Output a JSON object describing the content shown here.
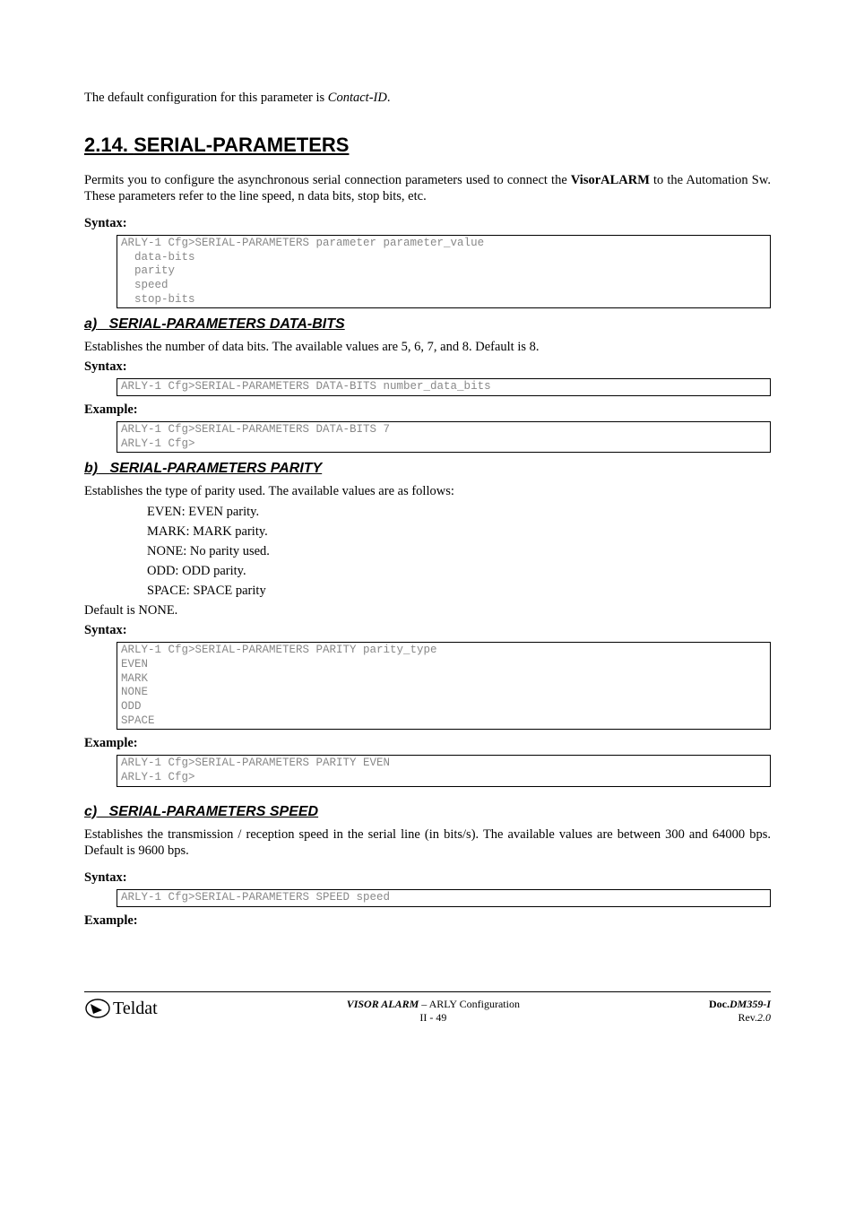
{
  "intro": {
    "defaultConfig_pre": "The default configuration for this parameter is ",
    "defaultConfig_em": "Contact-ID",
    "defaultConfig_post": "."
  },
  "section": {
    "number": "2.14.",
    "title": "SERIAL-PARAMETERS",
    "desc_pre": "Permits you to configure the asynchronous serial connection parameters used to connect the ",
    "desc_bold": "VisorALARM",
    "desc_post": " to the Automation Sw.  These parameters refer to the line speed, n data bits, stop bits, etc.",
    "syntax_label": "Syntax:",
    "syntax_code": "ARLY-1 Cfg>SERIAL-PARAMETERS parameter parameter_value\n  data-bits\n  parity\n  speed\n  stop-bits"
  },
  "a": {
    "heading_letter": "a)",
    "heading_text": "SERIAL-PARAMETERS DATA-BITS",
    "desc": "Establishes the number of data bits.  The available values are 5, 6, 7, and 8.  Default is 8.",
    "syntax_label": "Syntax:",
    "syntax_code": "ARLY-1 Cfg>SERIAL-PARAMETERS DATA-BITS number_data_bits",
    "example_label": "Example:",
    "example_code": "ARLY-1 Cfg>SERIAL-PARAMETERS DATA-BITS 7\nARLY-1 Cfg>"
  },
  "b": {
    "heading_letter": "b)",
    "heading_text": "SERIAL-PARAMETERS PARITY",
    "desc": "Establishes the type of parity used.  The available values are as follows:",
    "items": {
      "even": "EVEN: EVEN parity.",
      "mark": "MARK: MARK parity.",
      "none": "NONE: No parity used.",
      "odd": "ODD: ODD parity.",
      "space": "SPACE: SPACE parity"
    },
    "default": "Default is NONE.",
    "syntax_label": "Syntax:",
    "syntax_code": "ARLY-1 Cfg>SERIAL-PARAMETERS PARITY parity_type\nEVEN\nMARK\nNONE\nODD\nSPACE",
    "example_label": "Example:",
    "example_code": "ARLY-1 Cfg>SERIAL-PARAMETERS PARITY EVEN\nARLY-1 Cfg>"
  },
  "c": {
    "heading_letter": "c)",
    "heading_text": "SERIAL-PARAMETERS SPEED",
    "desc": "Establishes the transmission / reception speed in the serial line (in bits/s).  The available values are between 300 and 64000 bps.  Default is 9600 bps.",
    "syntax_label": "Syntax:",
    "syntax_code": "ARLY-1 Cfg>SERIAL-PARAMETERS SPEED speed",
    "example_label": "Example:"
  },
  "footer": {
    "logo_text": "Teldat",
    "center_main_italic": "VISOR ALARM",
    "center_main_rest": " – ARLY Configuration",
    "center_sub": "II - 49",
    "right_doc_label": "Doc.",
    "right_doc_value": "DM359-I",
    "right_rev_label": "Rev.",
    "right_rev_value": "2.0"
  }
}
